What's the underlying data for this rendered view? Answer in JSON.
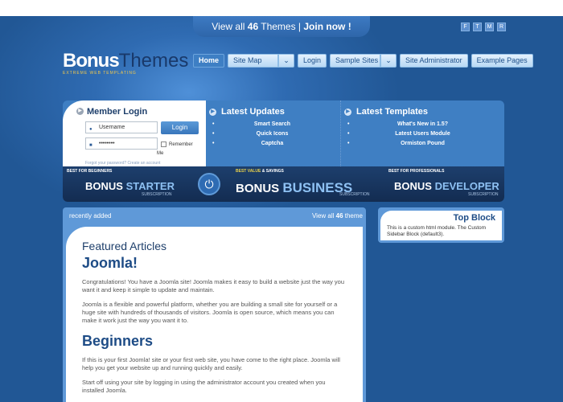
{
  "top": {
    "pre": "View all ",
    "count": "46",
    "mid": " Themes | ",
    "join": "Join now !",
    "social": [
      "F",
      "T",
      "M",
      "R"
    ]
  },
  "logo": {
    "part1": "Bonus",
    "part2": "Themes",
    "tagline": "EXTREME WEB TEMPLATING"
  },
  "nav": {
    "home": "Home",
    "sitemap": "Site Map",
    "login": "Login",
    "samples": "Sample Sites",
    "admin": "Site Administrator",
    "examples": "Example Pages",
    "caret": "⌄"
  },
  "login": {
    "title": "Member Login",
    "username_value": "Username",
    "password_value": "••••••••",
    "button": "Login",
    "remember": "Remember",
    "me": "Me",
    "forgot": "Forgot your password?   Create an account"
  },
  "updates": {
    "title": "Latest Updates",
    "items": [
      "Smart Search",
      "Quick Icons",
      "Captcha"
    ]
  },
  "templates": {
    "title": "Latest Templates",
    "items": [
      "What's New in 1.5?",
      "Latest Users Module",
      "Ormiston Pound"
    ]
  },
  "plans": [
    {
      "label": "BEST FOR BEGINNERS",
      "pre": "BONUS ",
      "big": "STARTER",
      "sub": "SUBSCRIPTION"
    },
    {
      "label_hi": "BEST VALUE",
      "label_rest": " & SAVINGS",
      "pre": "BONUS ",
      "big": "BUSINESS",
      "sub": "SUBSCRIPTION"
    },
    {
      "label": "BEST FOR PROFESSIONALS",
      "pre": "BONUS ",
      "big": "DEVELOPER",
      "sub": "SUBSCRIPTION"
    }
  ],
  "main": {
    "recent": "recently added",
    "viewall_pre": "View all ",
    "viewall_count": "46",
    "viewall_post": " theme",
    "featured": "Featured Articles",
    "h1": "Joomla!",
    "p1": "Congratulations! You have a Joomla site! Joomla makes it easy to build a website just the way you want it and keep it simple to update and maintain.",
    "p2": "Joomla is a flexible and powerful platform, whether you are building a small site for yourself or a huge site with hundreds of thousands of visitors. Joomla is open source, which means you can make it work just the way you want it to.",
    "h2": "Beginners",
    "p3": "If this is your first Joomla! site or your first web site, you have come to the right place. Joomla will help you get your website up and running quickly and easily.",
    "p4": "Start off using your site by logging in using the administrator account you created when you installed Joomla."
  },
  "side": {
    "title": "Top Block",
    "text": "This is a custom html module. The Custom Sidebar Block (default3)."
  }
}
